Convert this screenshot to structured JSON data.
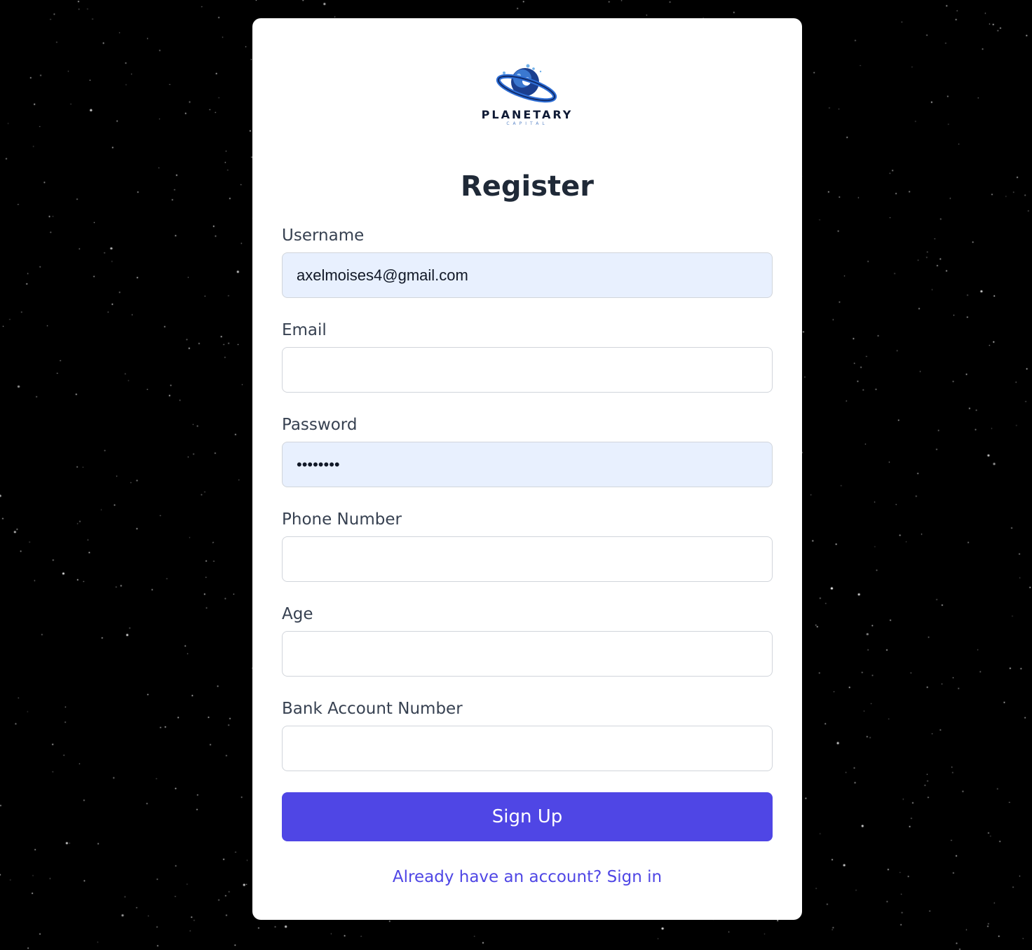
{
  "brand": {
    "name": "PLANETARY",
    "tagline": "CAPITAL",
    "logo_icon": "planet-ring-logo-icon",
    "colors": {
      "ring": "#2f6fd6",
      "planet": "#1b3f8f",
      "accent": "#6fb0ea"
    }
  },
  "page": {
    "title": "Register",
    "background": "starfield"
  },
  "form": {
    "fields": [
      {
        "label": "Username",
        "value": "axelmoises4@gmail.com",
        "type": "text",
        "autofilled": true
      },
      {
        "label": "Email",
        "value": "",
        "type": "email",
        "autofilled": false
      },
      {
        "label": "Password",
        "value": "••••••••",
        "type": "password",
        "autofilled": true
      },
      {
        "label": "Phone Number",
        "value": "",
        "type": "tel",
        "autofilled": false
      },
      {
        "label": "Age",
        "value": "",
        "type": "number",
        "autofilled": false
      },
      {
        "label": "Bank Account Number",
        "value": "",
        "type": "text",
        "autofilled": false
      }
    ],
    "submit_label": "Sign Up",
    "signin_link": "Already have an account? Sign in"
  },
  "colors": {
    "primary": "#4f46e5",
    "autofill_bg": "#e8f0fe",
    "heading": "#1f2937",
    "label": "#374151"
  }
}
